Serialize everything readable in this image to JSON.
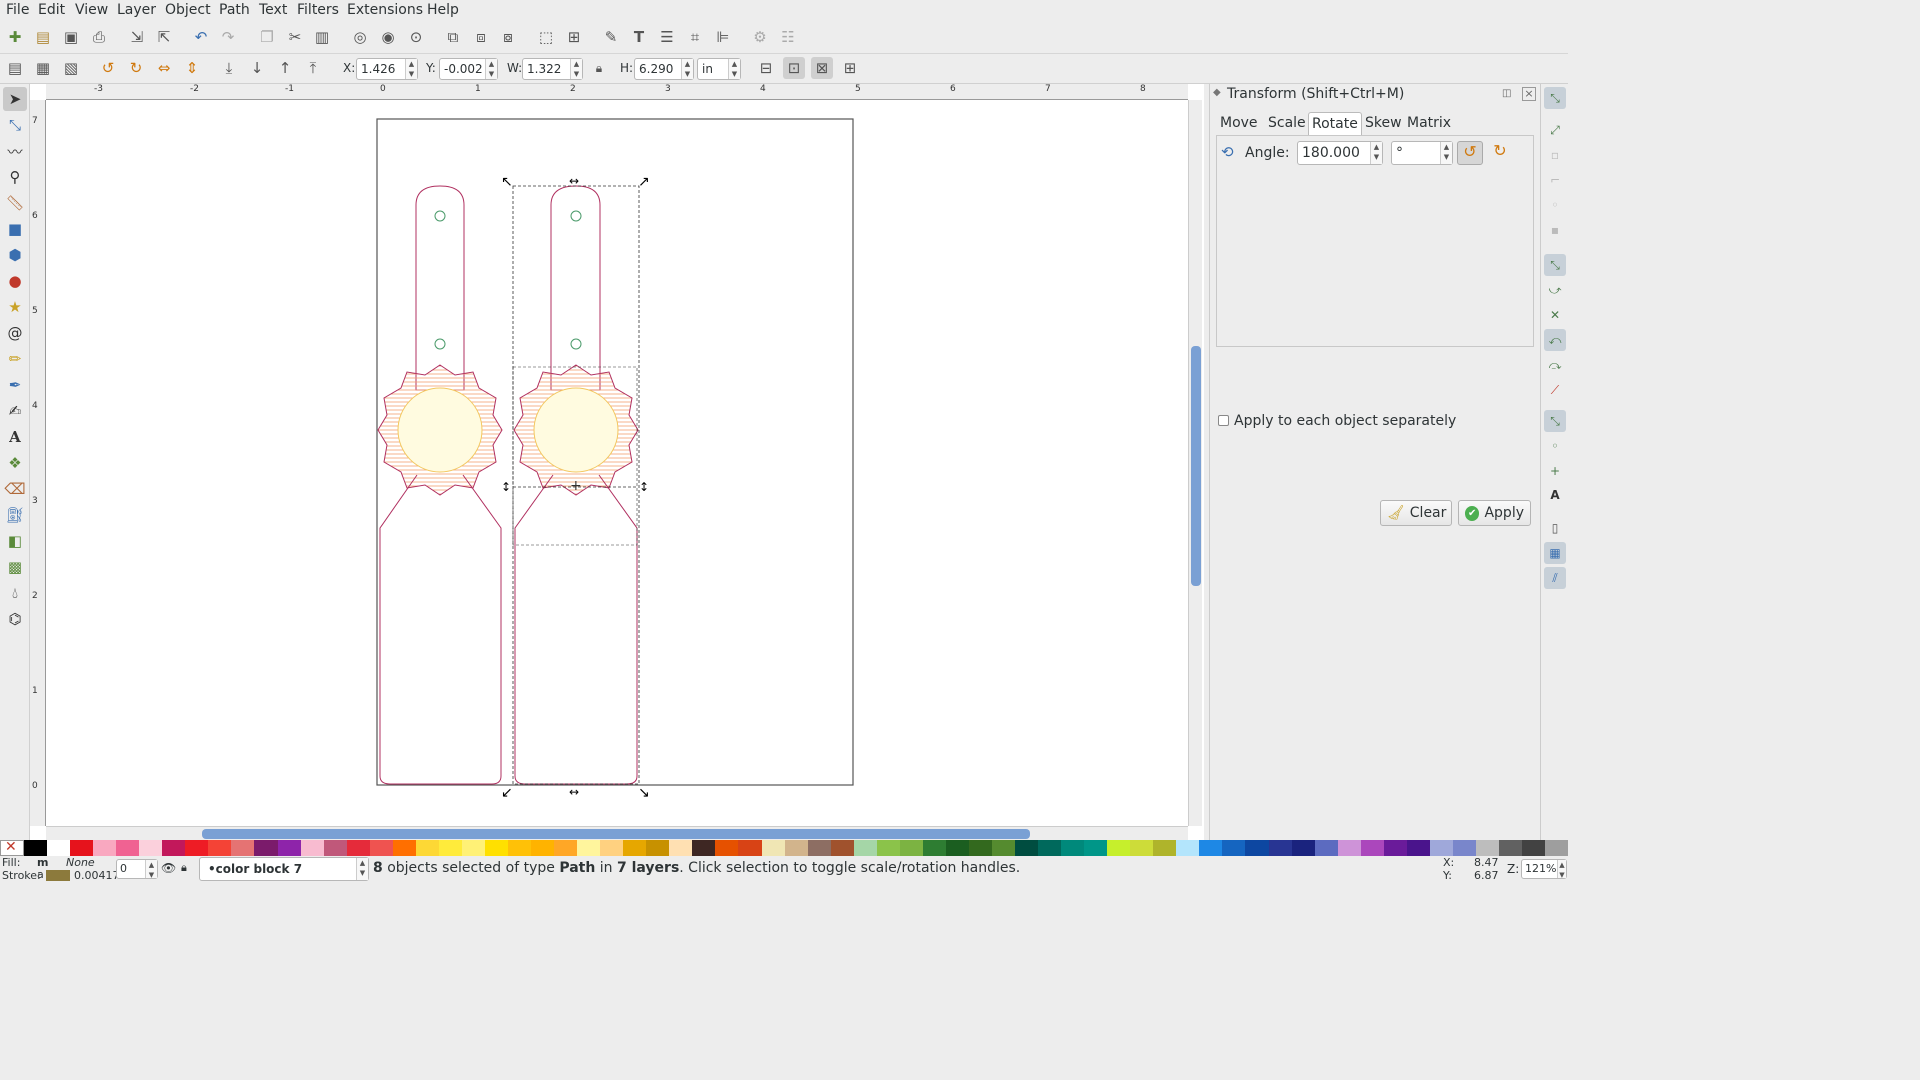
{
  "menu": [
    "File",
    "Edit",
    "View",
    "Layer",
    "Object",
    "Path",
    "Text",
    "Filters",
    "Extensions",
    "Help"
  ],
  "toolbar_ctrl": {
    "x_label": "X:",
    "x_value": "1.426",
    "y_label": "Y:",
    "y_value": "-0.002",
    "w_label": "W:",
    "w_value": "1.322",
    "h_label": "H:",
    "h_value": "6.290",
    "unit": "in"
  },
  "ruler": {
    "h_ticks": [
      "-3",
      "-2",
      "-1",
      "0",
      "1",
      "2",
      "3",
      "4",
      "5",
      "6",
      "7",
      "8"
    ],
    "v_ticks": [
      "7",
      "6",
      "5",
      "4",
      "3",
      "2",
      "1",
      "0"
    ]
  },
  "dialog": {
    "title": "Transform (Shift+Ctrl+M)",
    "tabs": [
      "Move",
      "Scale",
      "Rotate",
      "Skew",
      "Matrix"
    ],
    "active_tab": "Rotate",
    "angle_label": "Angle:",
    "angle_value": "180.000",
    "angle_unit": "°",
    "apply_each_label": "Apply to each object separately",
    "apply_each_checked": false,
    "clear_label": "Clear",
    "apply_label": "Apply"
  },
  "palette": [
    "#000000",
    "#ffffff",
    "#e6131c",
    "#f9a8c0",
    "#f06292",
    "#fbd0dc",
    "#c2185b",
    "#ee1c25",
    "#f44336",
    "#e57373",
    "#7b1b6b",
    "#8e24aa",
    "#f8bbd0",
    "#c0587a",
    "#e52b3a",
    "#ef5350",
    "#ff6f00",
    "#fdd835",
    "#ffeb3b",
    "#fff176",
    "#ffe000",
    "#ffc107",
    "#ffb300",
    "#ffa726",
    "#fff59d",
    "#ffd180",
    "#e6a700",
    "#c79100",
    "#ffe0b2",
    "#3e2723",
    "#e65100",
    "#d84315",
    "#f0e6b4",
    "#d2b48c",
    "#8d6e63",
    "#a0522d",
    "#a5d6a7",
    "#8bc34a",
    "#7cb342",
    "#2e7d32",
    "#1b5e20",
    "#33691e",
    "#558b2f",
    "#004d40",
    "#00695c",
    "#00897b",
    "#009688",
    "#c6ef2c",
    "#cddc39",
    "#afb42b",
    "#b3e5fc",
    "#1e88e5",
    "#1565c0",
    "#0d47a1",
    "#283593",
    "#1a237e",
    "#5c6bc0",
    "#ce93d8",
    "#ab47bc",
    "#6a1b9a",
    "#4a148c",
    "#9fa8da",
    "#7986cb",
    "#bdbdbd",
    "#616161",
    "#424242",
    "#9e9e9e"
  ],
  "status": {
    "fill_label": "Fill:",
    "fill_value": "m",
    "stroke_label": "Stroke:",
    "stroke_value": "a",
    "none_label": "None",
    "stroke_width": "0.00417",
    "opacity": "0",
    "layer": "•color block 7",
    "message_count": "8",
    "message_mid": " objects selected of type ",
    "message_type": "Path",
    "message_in": " in ",
    "message_layers": "7 layers",
    "message_tail": ". Click selection to toggle scale/rotation handles.",
    "x_label": "X:",
    "x_coord": "8.47",
    "y_label": "Y:",
    "y_coord": "6.87",
    "z_label": "Z:",
    "zoom": "121%"
  }
}
